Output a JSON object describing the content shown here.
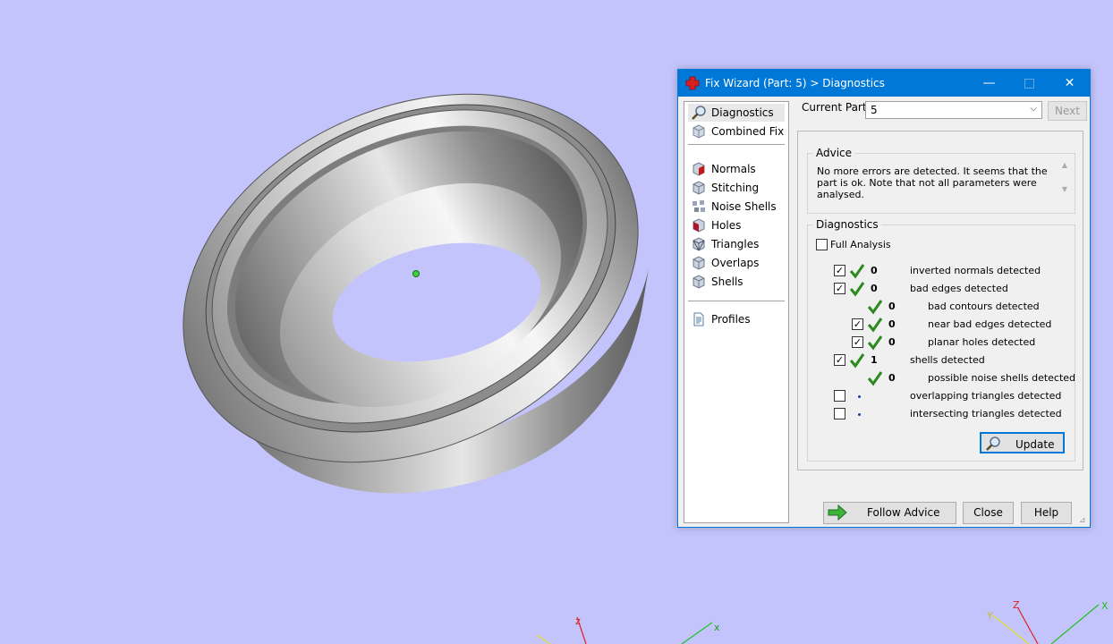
{
  "window": {
    "title": "Fix Wizard (Part: 5) > Diagnostics",
    "minimize_icon": "minimize-icon",
    "maximize_icon": "maximize-icon",
    "close_icon": "close-icon"
  },
  "nav": {
    "items": [
      {
        "label": "Diagnostics",
        "icon": "magnifier-icon"
      },
      {
        "label": "Combined Fix",
        "icon": "cube-icon"
      },
      {
        "label": "Normals",
        "icon": "normals-cube-icon"
      },
      {
        "label": "Stitching",
        "icon": "stitching-cube-icon"
      },
      {
        "label": "Noise Shells",
        "icon": "noise-shells-icon"
      },
      {
        "label": "Holes",
        "icon": "holes-cube-icon"
      },
      {
        "label": "Triangles",
        "icon": "triangles-cube-icon"
      },
      {
        "label": "Overlaps",
        "icon": "overlaps-cube-icon"
      },
      {
        "label": "Shells",
        "icon": "shells-cube-icon"
      },
      {
        "label": "Profiles",
        "icon": "document-icon"
      }
    ],
    "selected": "Diagnostics"
  },
  "current_part": {
    "label": "Current Part:",
    "value": "5",
    "next_label": "Next"
  },
  "advice": {
    "legend": "Advice",
    "text": "No more errors are detected. It seems that the part is ok. Note that not all parameters were analysed."
  },
  "diagnostics": {
    "legend": "Diagnostics",
    "full_analysis_label": "Full Analysis",
    "full_analysis_checked": false,
    "rows": [
      {
        "checked": true,
        "status": "ok",
        "count": "0",
        "text": "inverted normals detected"
      },
      {
        "checked": true,
        "status": "ok",
        "count": "0",
        "text": "bad edges detected"
      },
      {
        "checked": null,
        "status": "ok",
        "count": "0",
        "text": "bad contours detected"
      },
      {
        "checked": true,
        "status": "ok",
        "count": "0",
        "text": "near bad edges detected"
      },
      {
        "checked": true,
        "status": "ok",
        "count": "0",
        "text": "planar holes detected"
      },
      {
        "checked": true,
        "status": "ok",
        "count": "1",
        "text": "shells detected"
      },
      {
        "checked": null,
        "status": "ok",
        "count": "0",
        "text": "possible noise shells detected"
      },
      {
        "checked": false,
        "status": "pending",
        "count": "",
        "text": "overlapping triangles detected"
      },
      {
        "checked": false,
        "status": "pending",
        "count": "",
        "text": "intersecting triangles detected"
      }
    ],
    "update_label": "Update"
  },
  "buttons": {
    "follow_advice": "Follow Advice",
    "close": "Close",
    "help": "Help"
  },
  "viewport": {
    "background": "#c4c4fc",
    "axis_labels": [
      "X",
      "Z",
      "X",
      "Z",
      "Y"
    ]
  },
  "colors": {
    "titlebar": "#0078d7",
    "ok_tick": "#2a8a1e",
    "pending_dot": "#1b3fa8"
  }
}
